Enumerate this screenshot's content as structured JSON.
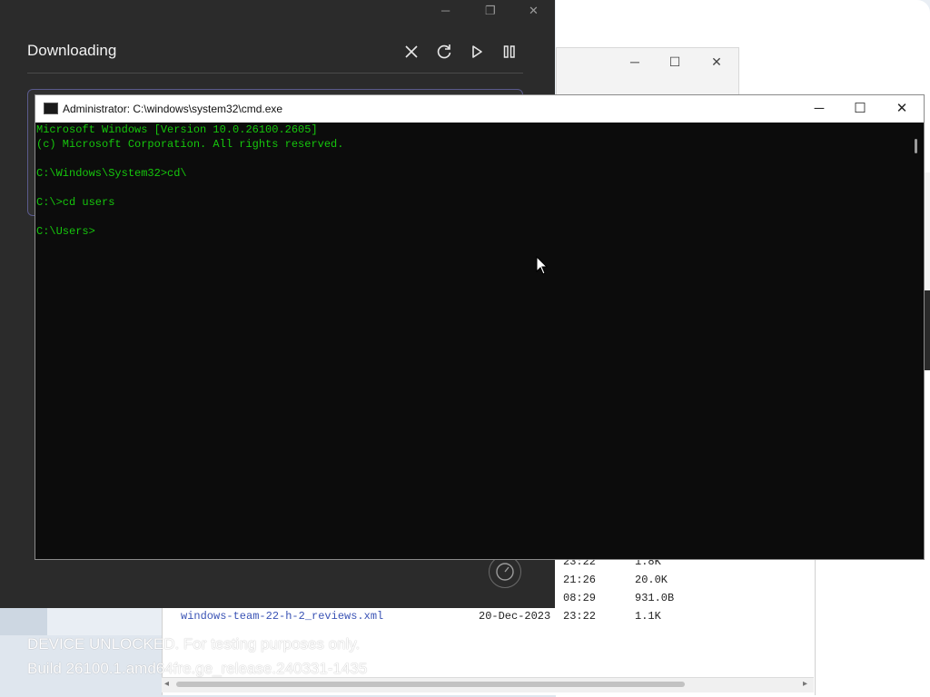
{
  "downloads": {
    "title": "Downloading",
    "controls": [
      "cancel",
      "retry",
      "play",
      "pause"
    ]
  },
  "cmd": {
    "title": "Administrator: C:\\windows\\system32\\cmd.exe",
    "lines": [
      "Microsoft Windows [Version 10.0.26100.2605]",
      "(c) Microsoft Corporation. All rights reserved.",
      "",
      "C:\\Windows\\System32>cd\\",
      "",
      "C:\\>cd users",
      "",
      "C:\\Users>"
    ]
  },
  "listing": {
    "rows": [
      {
        "name": "",
        "date": "",
        "time": "23:22",
        "size": "1.8K"
      },
      {
        "name": "",
        "date": "",
        "time": "21:26",
        "size": "20.0K"
      },
      {
        "name": "",
        "date": "",
        "time": "08:29",
        "size": "931.0B"
      },
      {
        "name": "windows-team-22-h-2_reviews.xml",
        "date": "20-Dec-2023",
        "time": "23:22",
        "size": "1.1K"
      }
    ]
  },
  "watermark": {
    "line1": "DEVICE UNLOCKED. For testing purposes only.",
    "line2": "Build 26100.1.amd64fre.ge_release.240331-1435"
  },
  "colors": {
    "console_text": "#16c60c",
    "console_bg": "#0c0c0c",
    "dialog_bg": "#2b2b2b",
    "link": "#3a53b5"
  }
}
